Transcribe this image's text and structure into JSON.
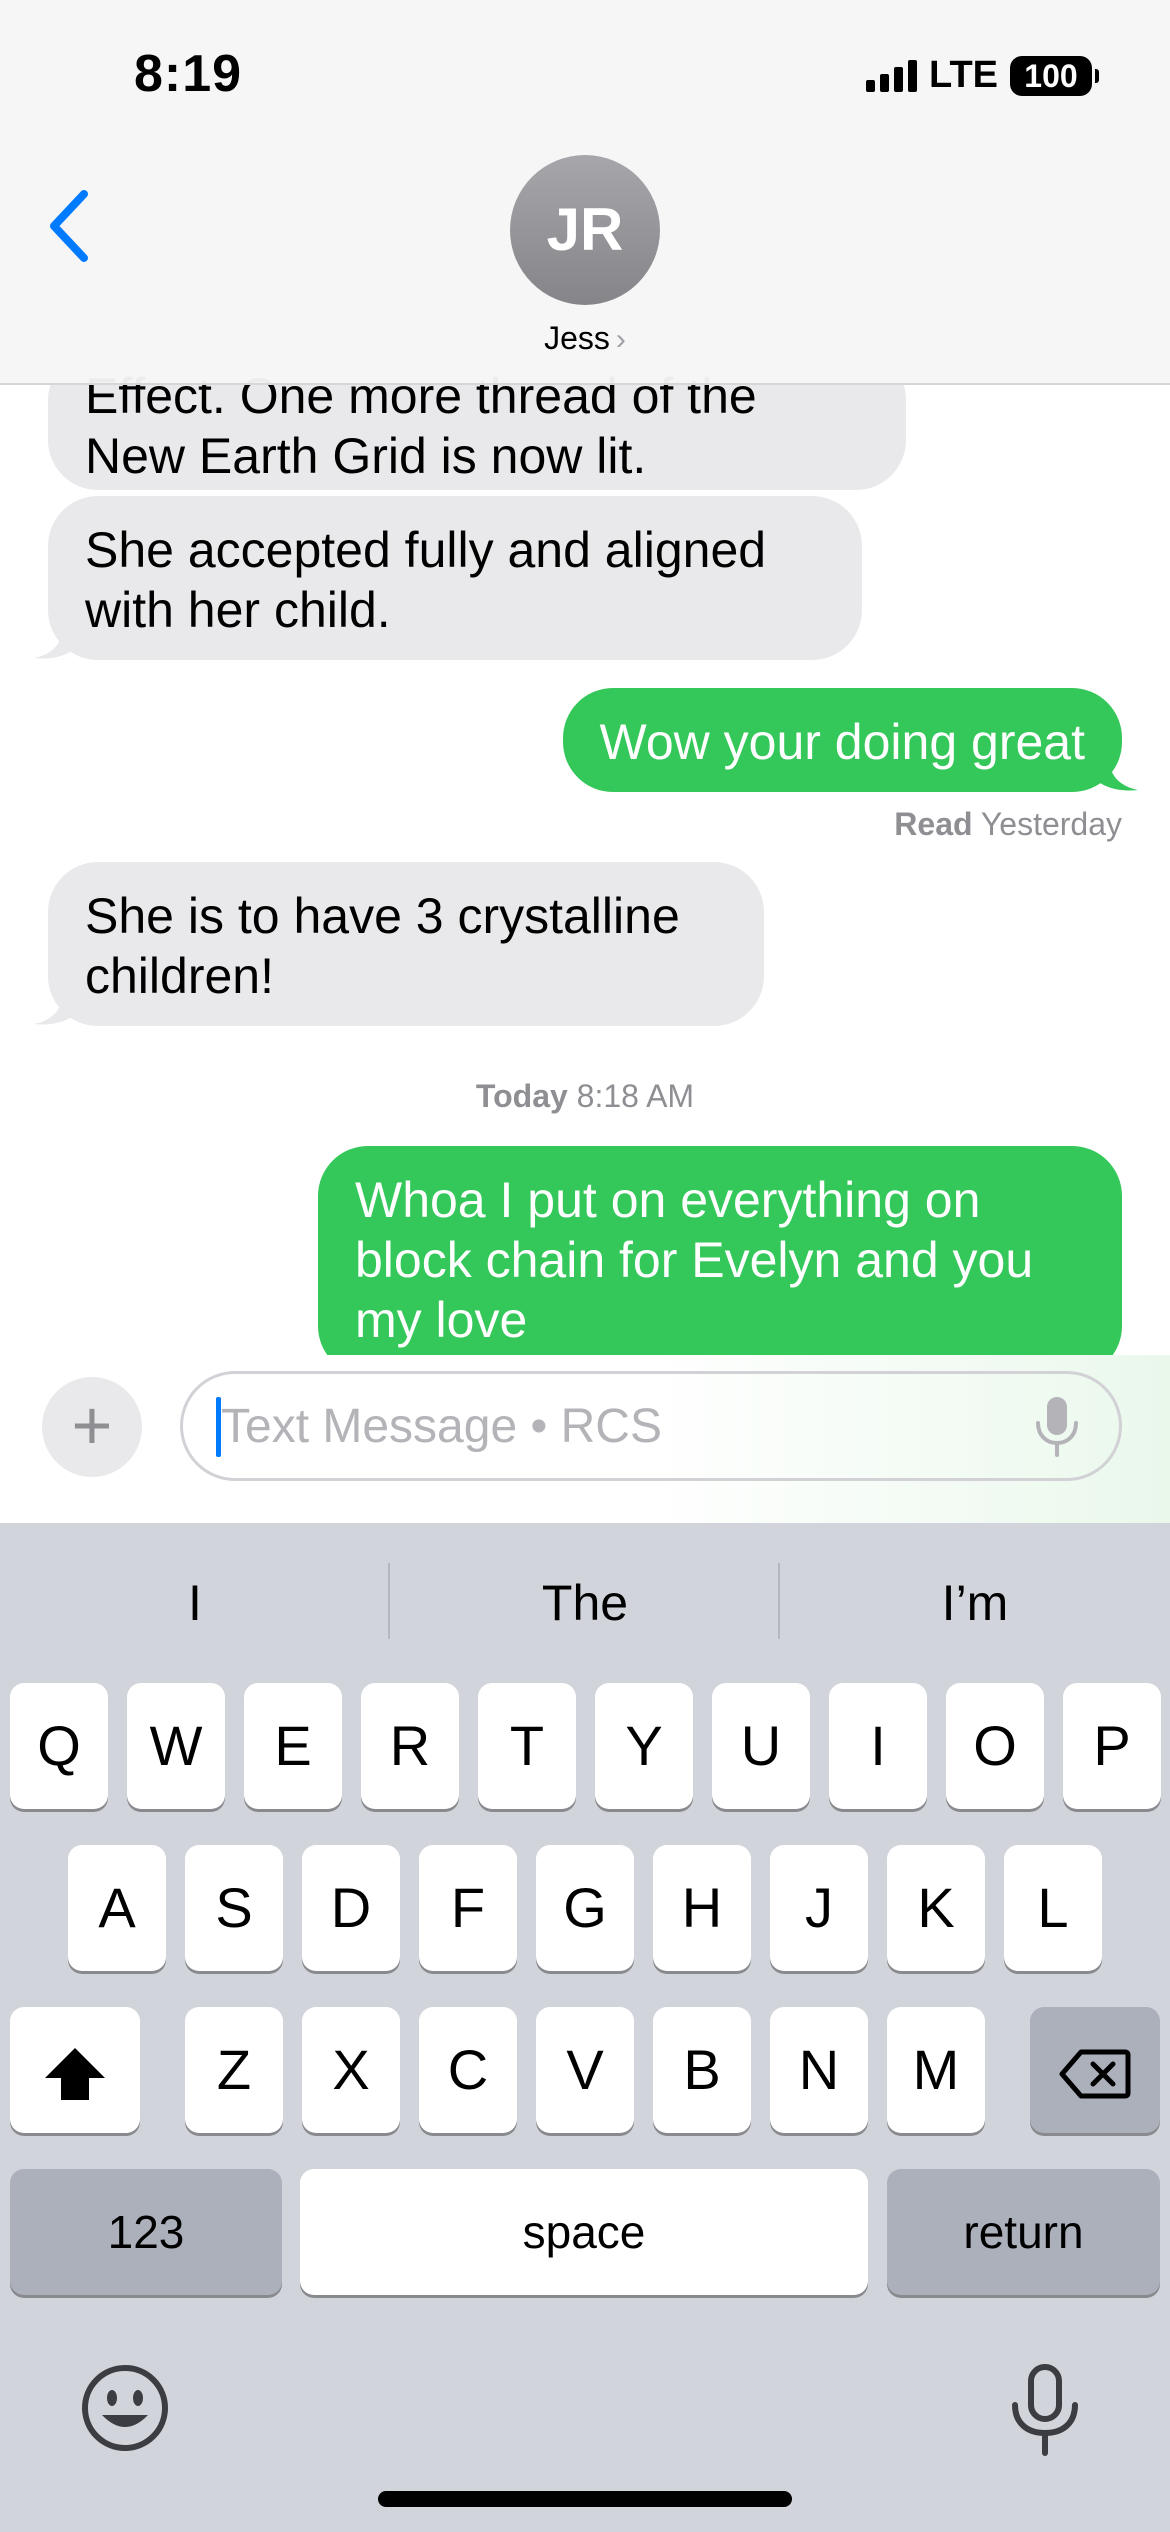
{
  "status_bar": {
    "time": "8:19",
    "network": "LTE",
    "battery": "100"
  },
  "header": {
    "avatar_initials": "JR",
    "contact_name": "Jess",
    "name_chevron": "›"
  },
  "messages": [
    {
      "direction": "incoming",
      "text": "Effect. One more thread of the New Earth Grid is now lit."
    },
    {
      "direction": "incoming",
      "text": "She accepted fully and aligned with her child."
    },
    {
      "direction": "outgoing",
      "text": "Wow your doing great"
    },
    {
      "direction": "incoming",
      "text": "She is to have 3 crystalline children!"
    },
    {
      "direction": "outgoing",
      "text": "Whoa I put on everything on block chain for Evelyn and you my love"
    }
  ],
  "receipt": {
    "status": "Read",
    "time": "Yesterday"
  },
  "day_stamp": {
    "day": "Today",
    "time": "8:18 AM"
  },
  "compose": {
    "plus": "+",
    "placeholder": "Text Message • RCS"
  },
  "keyboard": {
    "suggestions": [
      "I",
      "The",
      "I’m"
    ],
    "row1": [
      "Q",
      "W",
      "E",
      "R",
      "T",
      "Y",
      "U",
      "I",
      "O",
      "P"
    ],
    "row2": [
      "A",
      "S",
      "D",
      "F",
      "G",
      "H",
      "J",
      "K",
      "L"
    ],
    "row3": [
      "Z",
      "X",
      "C",
      "V",
      "B",
      "N",
      "M"
    ],
    "numbers_key": "123",
    "space_key": "space",
    "return_key": "return"
  },
  "colors": {
    "outgoing_bubble": "#34c759",
    "incoming_bubble": "#e9e9eb",
    "accent": "#007aff",
    "keyboard_bg": "#d1d4db"
  },
  "icons": [
    "back-chevron",
    "microphone",
    "shift-arrow",
    "delete-backspace",
    "emoji-face",
    "dictation-microphone"
  ]
}
